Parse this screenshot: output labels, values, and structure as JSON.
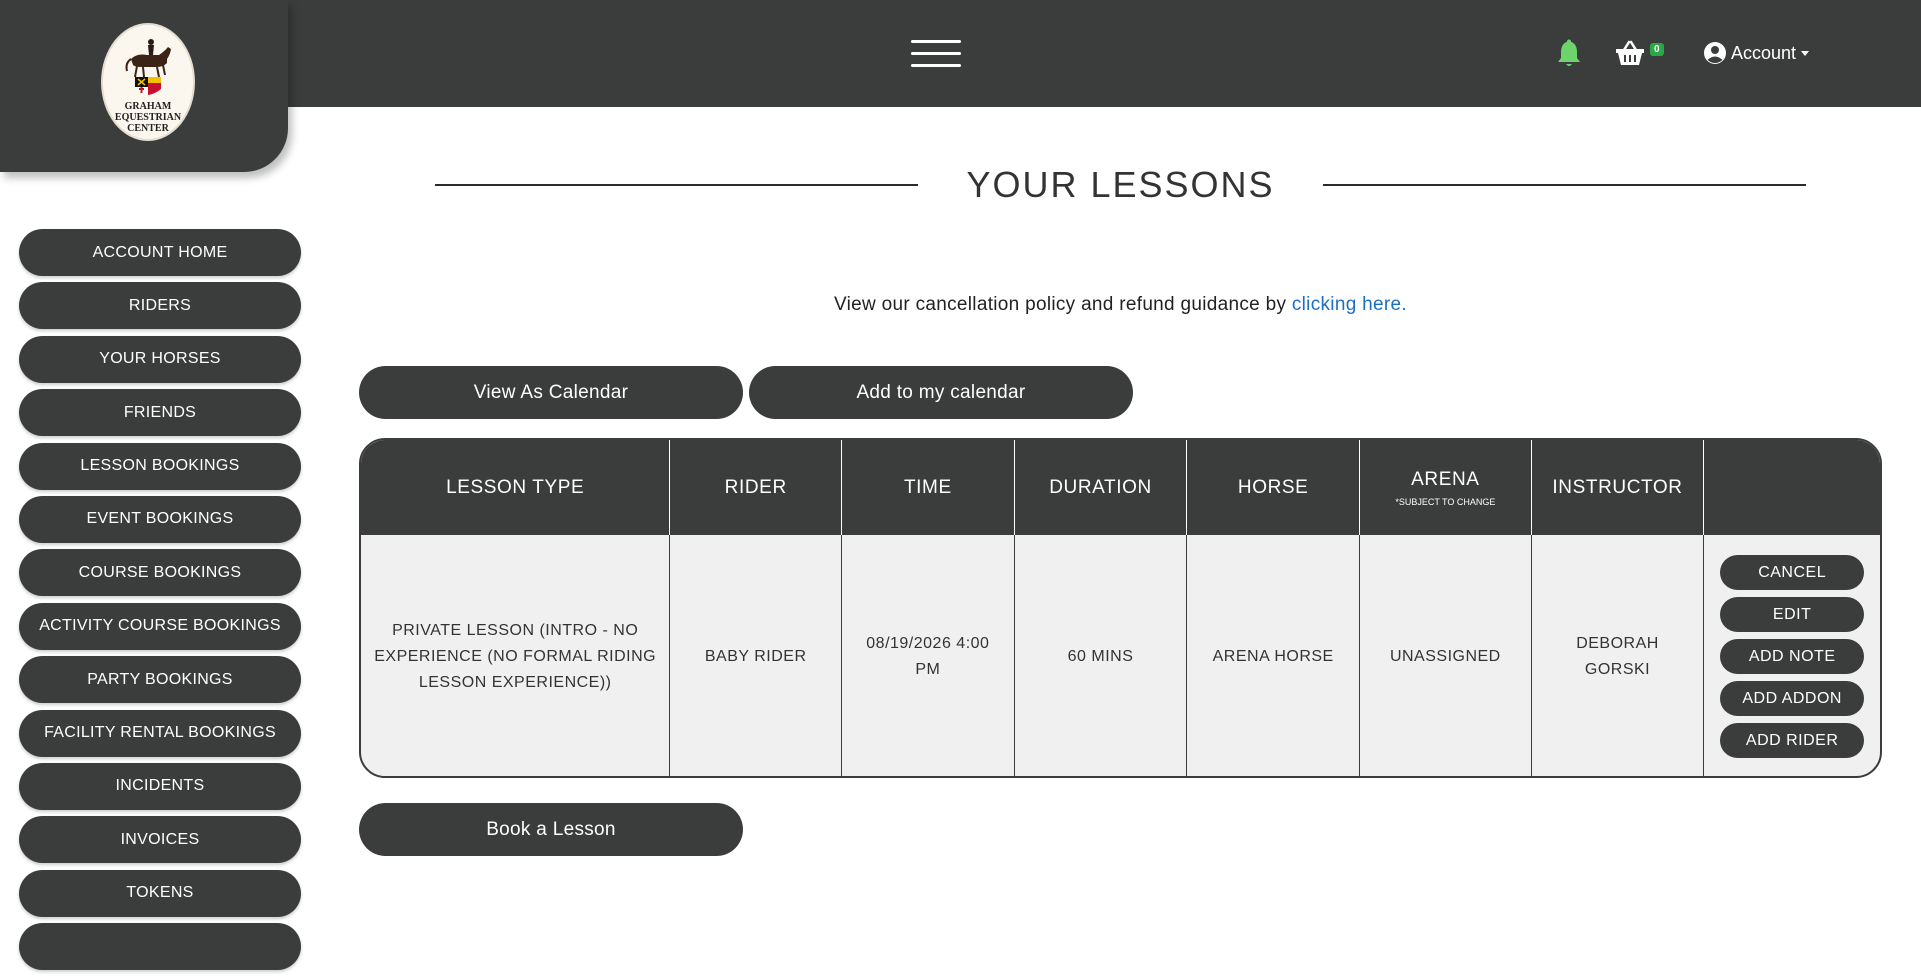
{
  "brand": {
    "logo_lines": [
      "GRAHAM",
      "EQUESTRIAN",
      "CENTER"
    ]
  },
  "header": {
    "cart_count": "0",
    "account_label": "Account"
  },
  "sidebar": {
    "items": [
      {
        "label": "ACCOUNT HOME"
      },
      {
        "label": "RIDERS"
      },
      {
        "label": "YOUR HORSES"
      },
      {
        "label": "FRIENDS"
      },
      {
        "label": "LESSON BOOKINGS"
      },
      {
        "label": "EVENT BOOKINGS"
      },
      {
        "label": "COURSE BOOKINGS"
      },
      {
        "label": "ACTIVITY COURSE BOOKINGS"
      },
      {
        "label": "PARTY BOOKINGS"
      },
      {
        "label": "FACILITY RENTAL BOOKINGS"
      },
      {
        "label": "INCIDENTS"
      },
      {
        "label": "INVOICES"
      },
      {
        "label": "TOKENS"
      }
    ]
  },
  "main": {
    "title": "YOUR LESSONS",
    "policy_text": "View our cancellation policy and refund guidance by ",
    "policy_link": "clicking here.",
    "view_calendar_label": "View As Calendar",
    "add_calendar_label": "Add to my calendar",
    "book_lesson_label": "Book a Lesson"
  },
  "table": {
    "headers": {
      "lesson_type": "LESSON TYPE",
      "rider": "RIDER",
      "time": "TIME",
      "duration": "DURATION",
      "horse": "HORSE",
      "arena": "ARENA",
      "arena_note": "*SUBJECT TO CHANGE",
      "instructor": "INSTRUCTOR"
    },
    "rows": [
      {
        "lesson_type": "PRIVATE LESSON (INTRO - NO EXPERIENCE (NO FORMAL RIDING LESSON EXPERIENCE))",
        "rider": "BABY RIDER",
        "time": "08/19/2026 4:00 PM",
        "duration": "60 MINS",
        "horse": "ARENA HORSE",
        "arena": "UNASSIGNED",
        "instructor": "DEBORAH GORSKI",
        "actions": {
          "cancel": "CANCEL",
          "edit": "EDIT",
          "add_note": "ADD NOTE",
          "add_addon": "ADD ADDON",
          "add_rider": "ADD RIDER"
        }
      }
    ]
  },
  "colors": {
    "dark": "#3a3d3c",
    "link": "#1a6fc4",
    "bell": "#6cd46c",
    "badge": "#2aa845"
  }
}
